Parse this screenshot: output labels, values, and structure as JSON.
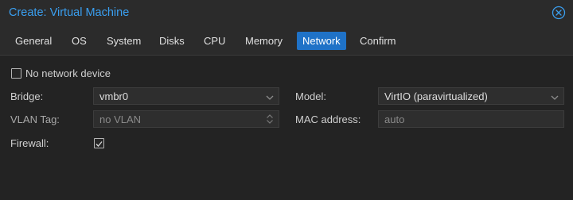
{
  "window": {
    "title": "Create: Virtual Machine",
    "close_icon": "close-circle-icon"
  },
  "tabs": [
    {
      "label": "General",
      "active": false
    },
    {
      "label": "OS",
      "active": false
    },
    {
      "label": "System",
      "active": false
    },
    {
      "label": "Disks",
      "active": false
    },
    {
      "label": "CPU",
      "active": false
    },
    {
      "label": "Memory",
      "active": false
    },
    {
      "label": "Network",
      "active": true
    },
    {
      "label": "Confirm",
      "active": false
    }
  ],
  "form": {
    "no_network_device": {
      "label": "No network device",
      "checked": false
    },
    "bridge": {
      "label": "Bridge:",
      "value": "vmbr0",
      "icon": "chevron-down-icon"
    },
    "vlan_tag": {
      "label": "VLAN Tag:",
      "placeholder": "no VLAN",
      "icon": "spinner-updown-icon"
    },
    "firewall": {
      "label": "Firewall:",
      "checked": true,
      "icon": "checkmark-icon"
    },
    "model": {
      "label": "Model:",
      "value": "VirtIO (paravirtualized)",
      "icon": "chevron-down-icon"
    },
    "mac_address": {
      "label": "MAC address:",
      "placeholder": "auto"
    }
  },
  "colors": {
    "accent": "#1f72c7",
    "title": "#3a9ff0",
    "background": "#252526"
  }
}
